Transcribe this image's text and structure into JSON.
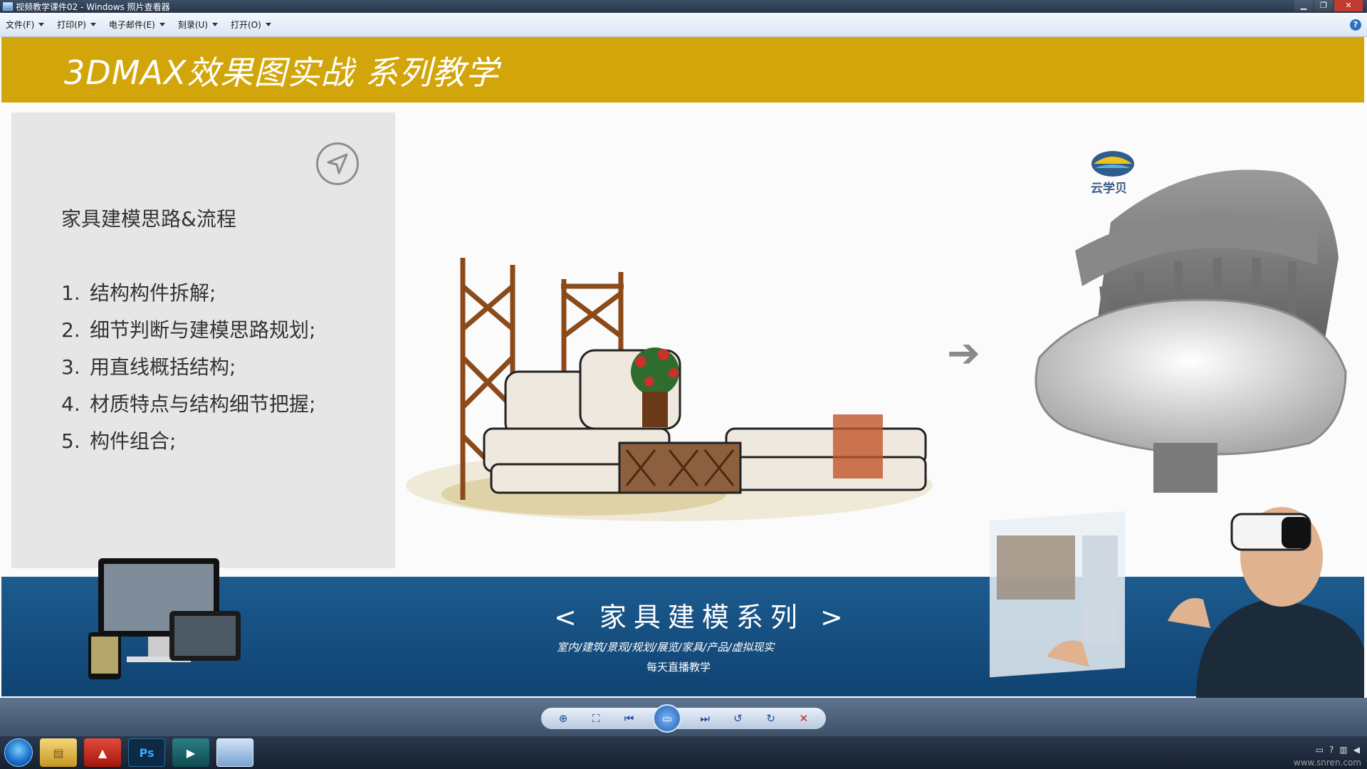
{
  "window": {
    "title": "视频教学课件02 - Windows 照片查看器",
    "min_label": "▁",
    "max_label": "❐",
    "close_label": "✕"
  },
  "menu": {
    "items": [
      {
        "label": "文件(F)"
      },
      {
        "label": "打印(P)"
      },
      {
        "label": "电子邮件(E)"
      },
      {
        "label": "刻录(U)"
      },
      {
        "label": "打开(O)"
      }
    ],
    "help_label": "?"
  },
  "slide": {
    "header_title": "3DMAX效果图实战  系列教学",
    "panel": {
      "title": "家具建模思路&流程",
      "steps": [
        {
          "num": "1.",
          "text": "结构构件拆解;"
        },
        {
          "num": "2.",
          "text": "细节判断与建模思路规划;"
        },
        {
          "num": "3.",
          "text": "用直线概括结构;"
        },
        {
          "num": "4.",
          "text": "材质特点与结构细节把握;"
        },
        {
          "num": "5.",
          "text": "构件组合;"
        }
      ]
    },
    "arrow_glyph": "➔",
    "logo_text": "云学贝",
    "bottom": {
      "series": "< 家具建模系列 >",
      "subjects": "室内/建筑/景观/规划/展览/家具/产品/虚拟现实",
      "daily": "每天直播教学"
    }
  },
  "toolbar": {
    "zoom_icon": "⊕",
    "fit_icon": "⛶",
    "prev_icon": "⏮",
    "slideshow_icon": "▭",
    "next_icon": "⏭",
    "rotate_left_icon": "↺",
    "rotate_right_icon": "↻",
    "delete_icon": "✕"
  },
  "taskbar": {
    "ps_label": "Ps",
    "watermark": "www.snren.com"
  }
}
